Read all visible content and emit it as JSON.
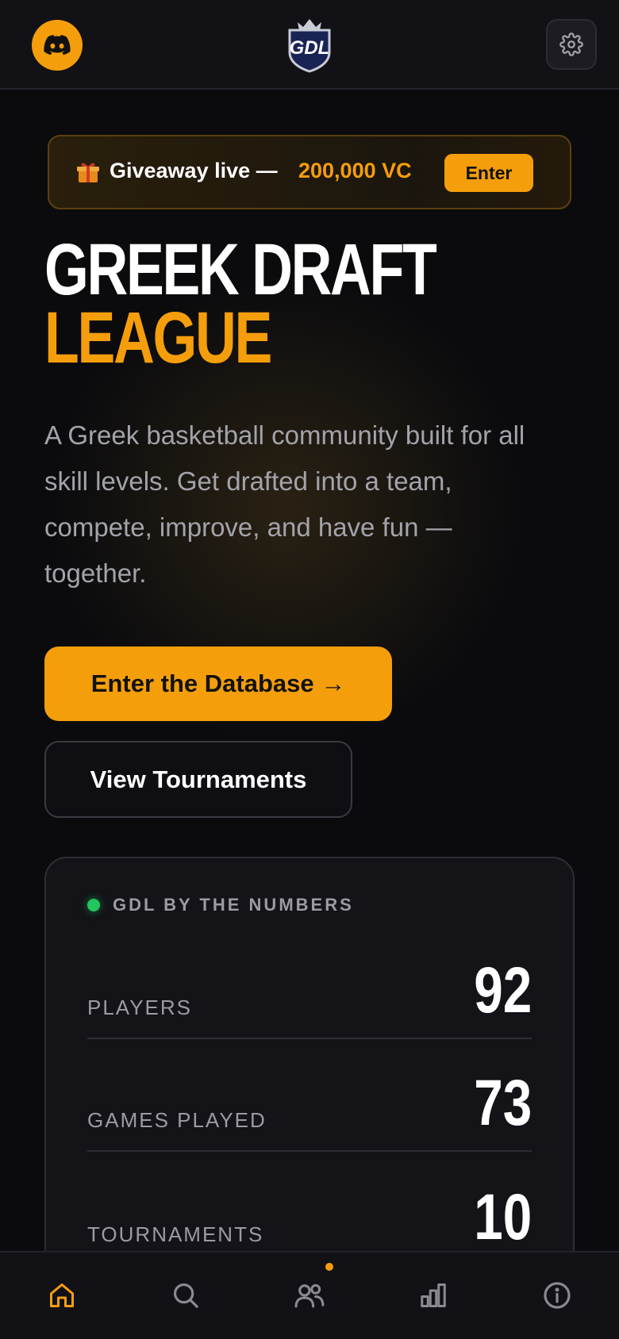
{
  "header": {
    "discord_icon": "discord-icon",
    "logo_text": "GDL",
    "settings_icon": "gear-icon"
  },
  "giveaway": {
    "icon": "gift-icon",
    "text": "Giveaway live —",
    "amount": "200,000 VC",
    "button_label": "Enter"
  },
  "hero": {
    "title_line1": "GREEK DRAFT",
    "title_line2": "LEAGUE",
    "description": "A Greek basketball community built for all skill levels. Get drafted into a team, compete, improve, and have fun — together.",
    "primary_button": "Enter the Database →",
    "secondary_button": "View Tournaments"
  },
  "stats": {
    "title": "GDL BY THE NUMBERS",
    "rows": [
      {
        "label": "PLAYERS",
        "value": "92"
      },
      {
        "label": "GAMES PLAYED",
        "value": "73"
      },
      {
        "label": "TOURNAMENTS",
        "value": "10"
      }
    ]
  },
  "bottom_nav": {
    "items": [
      {
        "icon": "home-icon",
        "active": true
      },
      {
        "icon": "search-icon",
        "active": false
      },
      {
        "icon": "users-icon",
        "active": false,
        "notification": true
      },
      {
        "icon": "stats-icon",
        "active": false
      },
      {
        "icon": "info-icon",
        "active": false
      }
    ]
  },
  "colors": {
    "accent": "#f59e0b",
    "background": "#0b0b0e",
    "surface": "#131318",
    "muted_text": "#9b9ba3",
    "live": "#22c55e"
  }
}
